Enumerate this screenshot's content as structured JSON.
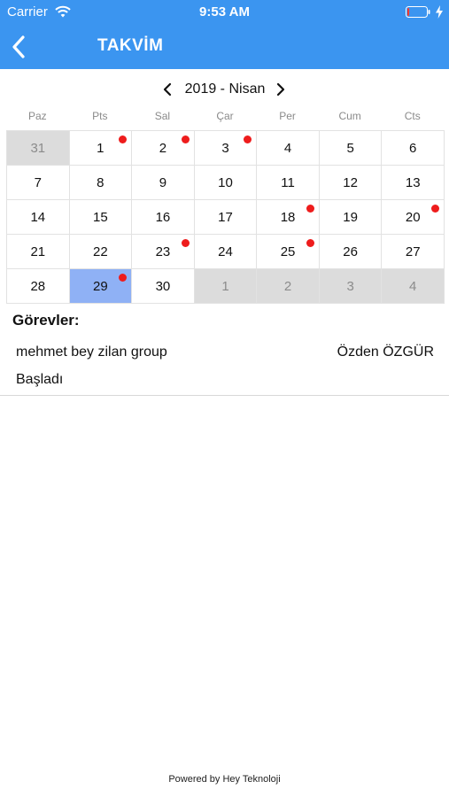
{
  "status_bar": {
    "carrier": "Carrier",
    "time": "9:53 AM",
    "battery_level": 0.1,
    "battery_color": "#ff3b30"
  },
  "nav": {
    "back_icon": "chevron-left-icon",
    "title": "TAKVİM",
    "background": "#3b95f0"
  },
  "calendar": {
    "month_label": "2019 - Nisan",
    "prev_icon": "chevron-left-icon",
    "next_icon": "chevron-right-icon",
    "weekdays": [
      "Paz",
      "Pts",
      "Sal",
      "Çar",
      "Per",
      "Cum",
      "Cts"
    ],
    "days": [
      {
        "label": "31",
        "outside": true,
        "event": false,
        "selected": false
      },
      {
        "label": "1",
        "outside": false,
        "event": true,
        "selected": false
      },
      {
        "label": "2",
        "outside": false,
        "event": true,
        "selected": false
      },
      {
        "label": "3",
        "outside": false,
        "event": true,
        "selected": false
      },
      {
        "label": "4",
        "outside": false,
        "event": false,
        "selected": false
      },
      {
        "label": "5",
        "outside": false,
        "event": false,
        "selected": false
      },
      {
        "label": "6",
        "outside": false,
        "event": false,
        "selected": false
      },
      {
        "label": "7",
        "outside": false,
        "event": false,
        "selected": false
      },
      {
        "label": "8",
        "outside": false,
        "event": false,
        "selected": false
      },
      {
        "label": "9",
        "outside": false,
        "event": false,
        "selected": false
      },
      {
        "label": "10",
        "outside": false,
        "event": false,
        "selected": false
      },
      {
        "label": "11",
        "outside": false,
        "event": false,
        "selected": false
      },
      {
        "label": "12",
        "outside": false,
        "event": false,
        "selected": false
      },
      {
        "label": "13",
        "outside": false,
        "event": false,
        "selected": false
      },
      {
        "label": "14",
        "outside": false,
        "event": false,
        "selected": false
      },
      {
        "label": "15",
        "outside": false,
        "event": false,
        "selected": false
      },
      {
        "label": "16",
        "outside": false,
        "event": false,
        "selected": false
      },
      {
        "label": "17",
        "outside": false,
        "event": false,
        "selected": false
      },
      {
        "label": "18",
        "outside": false,
        "event": true,
        "selected": false
      },
      {
        "label": "19",
        "outside": false,
        "event": false,
        "selected": false
      },
      {
        "label": "20",
        "outside": false,
        "event": true,
        "selected": false
      },
      {
        "label": "21",
        "outside": false,
        "event": false,
        "selected": false
      },
      {
        "label": "22",
        "outside": false,
        "event": false,
        "selected": false
      },
      {
        "label": "23",
        "outside": false,
        "event": true,
        "selected": false
      },
      {
        "label": "24",
        "outside": false,
        "event": false,
        "selected": false
      },
      {
        "label": "25",
        "outside": false,
        "event": true,
        "selected": false
      },
      {
        "label": "26",
        "outside": false,
        "event": false,
        "selected": false
      },
      {
        "label": "27",
        "outside": false,
        "event": false,
        "selected": false
      },
      {
        "label": "28",
        "outside": false,
        "event": false,
        "selected": false
      },
      {
        "label": "29",
        "outside": false,
        "event": true,
        "selected": true
      },
      {
        "label": "30",
        "outside": false,
        "event": false,
        "selected": false
      },
      {
        "label": "1",
        "outside": true,
        "event": false,
        "selected": false
      },
      {
        "label": "2",
        "outside": true,
        "event": false,
        "selected": false
      },
      {
        "label": "3",
        "outside": true,
        "event": false,
        "selected": false
      },
      {
        "label": "4",
        "outside": true,
        "event": false,
        "selected": false
      }
    ],
    "colors": {
      "event_dot": "#ee1c1c",
      "selected": "#8fb1f5",
      "outside": "#dcdcdc"
    }
  },
  "tasks": {
    "title": "Görevler:",
    "items": [
      {
        "name": "mehmet bey zilan group",
        "person": "Özden ÖZGÜR",
        "status": "Başladı"
      }
    ]
  },
  "footer": {
    "text": "Powered by Hey Teknoloji"
  }
}
